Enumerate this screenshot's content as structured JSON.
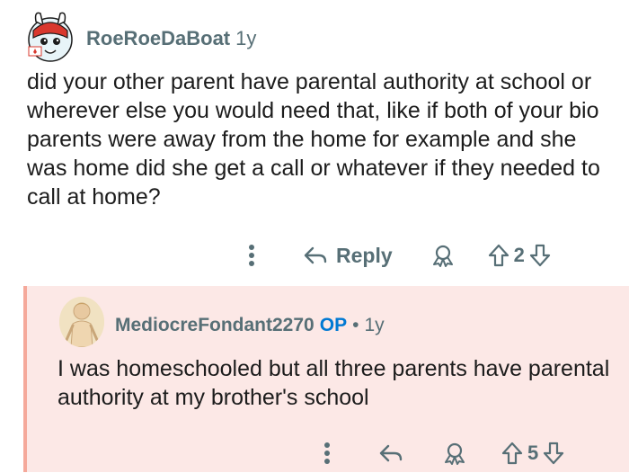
{
  "comment": {
    "username": "RoeRoeDaBoat",
    "age": "1y",
    "text": "did your other parent have parental authority at school or wherever else you would need that, like if both of your bio parents were away from the home for example and she was home did she get a call or whatever if they needed to call at home?",
    "reply_label": "Reply",
    "vote_count": "2"
  },
  "reply": {
    "username": "MediocreFondant2270",
    "op_badge": "OP",
    "separator": "•",
    "age": "1y",
    "text": "I was homeschooled but all three parents have parental authority at my brother's school",
    "vote_count": "5"
  },
  "colors": {
    "meta_gray": "#576f76",
    "op_blue": "#0079d3",
    "reply_bg": "#fce8e6",
    "thread_line": "#f5a99b"
  },
  "icons": [
    "avatar-bunny-icon",
    "more-options-icon",
    "reply-arrow-icon",
    "award-icon",
    "upvote-icon",
    "downvote-icon"
  ]
}
